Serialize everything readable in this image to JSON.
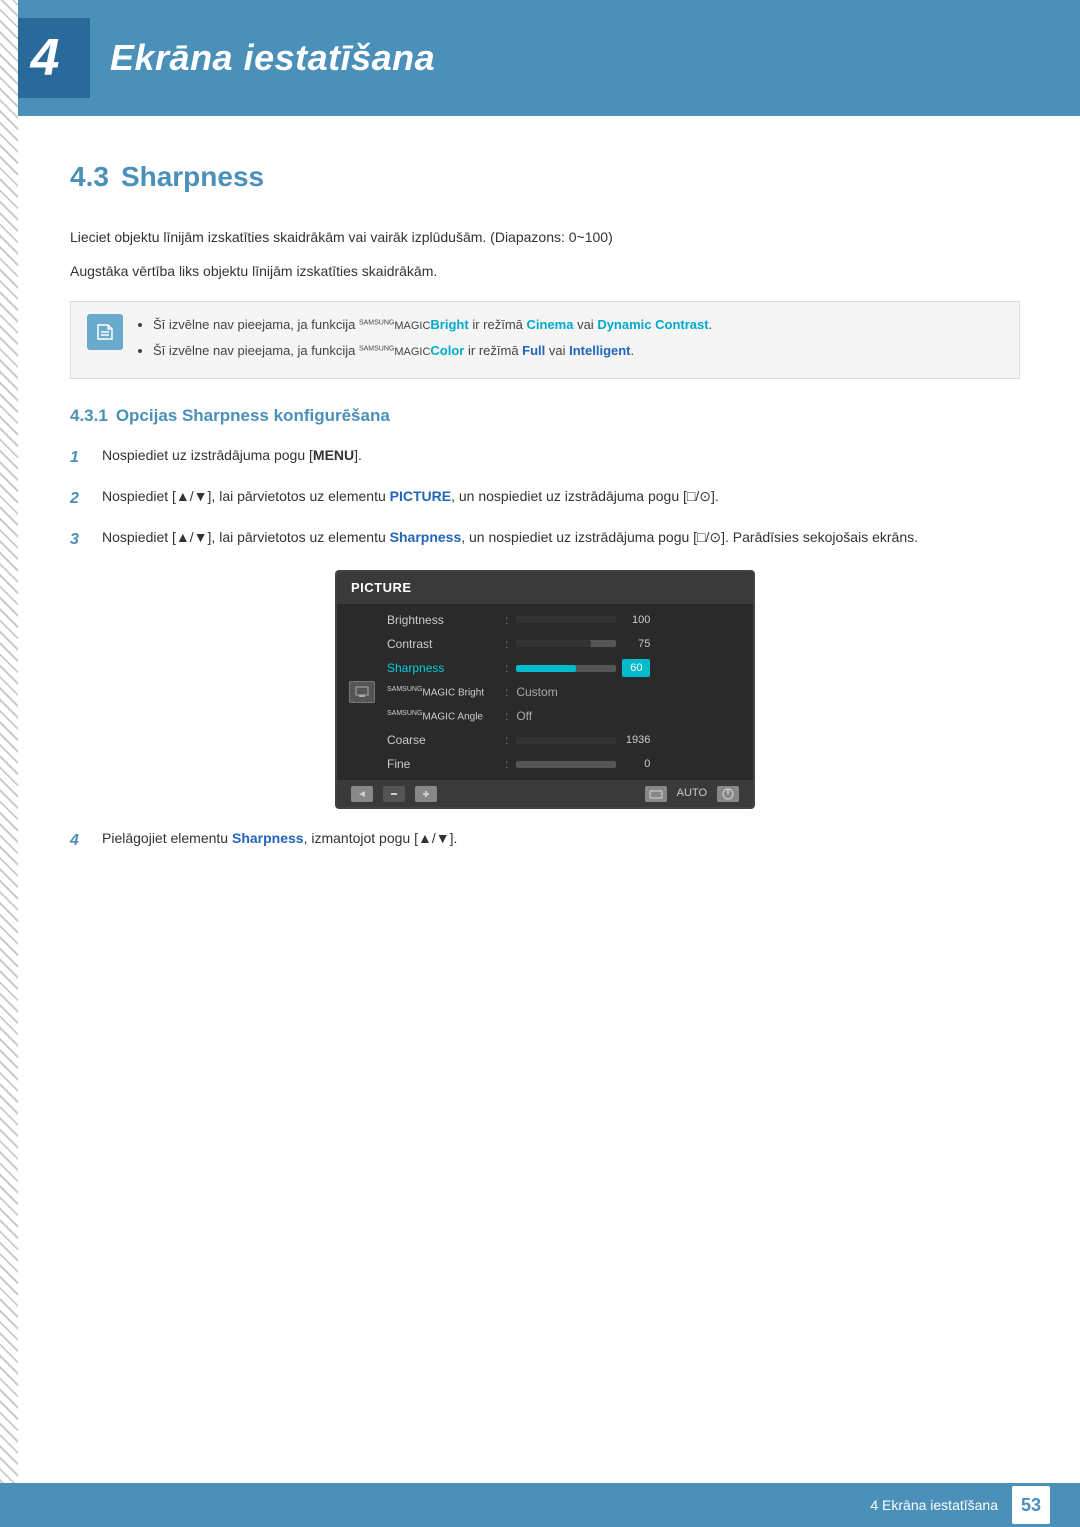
{
  "chapter": {
    "number": "4",
    "title": "Ekrāna iestatīšana"
  },
  "section": {
    "number": "4.3",
    "title": "Sharpness",
    "description1": "Lieciet objektu līnijām izskatīties skaidrākām vai vairāk izplūdušām. (Diapazons: 0~100)",
    "description2": "Augstāka vērtība liks objektu līnijām izskatīties skaidrākām.",
    "note1": "Šī izvēlne nav pieejama, ja funkcija ",
    "note1_brand": "SAMSUNG",
    "note1_magic": "MAGIC",
    "note1_feature": "Bright",
    "note1_mid": " ir režīmā ",
    "note1_cinema": "Cinema",
    "note1_or": " vai ",
    "note1_contrast": "Dynamic Contrast",
    "note1_end": ".",
    "note2": "Šī izvēlne nav pieejama, ja funkcija ",
    "note2_brand": "SAMSUNG",
    "note2_magic": "MAGIC",
    "note2_feature": "Color",
    "note2_mid": " ir režīmā ",
    "note2_full": "Full",
    "note2_or": " vai ",
    "note2_intelligent": "Intelligent",
    "note2_end": ".",
    "subsection": {
      "number": "4.3.1",
      "title": "Opcijas Sharpness konfigurēšana",
      "steps": [
        {
          "num": "1",
          "text": "Nospiediet uz izstrādājuma pogu [",
          "bold": "MENU",
          "text2": "]."
        },
        {
          "num": "2",
          "text": "Nospiediet [▲/▼], lai pārvietotos uz elementu ",
          "bold": "PICTURE",
          "text2": ", un nospiediet uz izstrādājuma pogu [□/⊙]."
        },
        {
          "num": "3",
          "text": "Nospiediet [▲/▼], lai pārvietotos uz elementu ",
          "bold": "Sharpness",
          "text2": ", un nospiediet uz izstrādājuma pogu [□/⊙]. Parādīsies sekojošais ekrāns."
        },
        {
          "num": "4",
          "text": "Pielāgojiet elementu ",
          "bold": "Sharpness",
          "text2": ", izmantojot pogu [▲/▼]."
        }
      ]
    }
  },
  "monitor_ui": {
    "title": "PICTURE",
    "rows": [
      {
        "label": "Brightness",
        "type": "bar",
        "fill": 100,
        "value": "100"
      },
      {
        "label": "Contrast",
        "type": "bar",
        "fill": 75,
        "value": "75"
      },
      {
        "label": "Sharpness",
        "type": "bar_selected",
        "fill": 60,
        "value": "60"
      },
      {
        "label": "SAMSUNG MAGIC Bright",
        "type": "text",
        "value": "Custom"
      },
      {
        "label": "SAMSUNG MAGIC Angle",
        "type": "text",
        "value": "Off"
      },
      {
        "label": "Coarse",
        "type": "bar",
        "fill": 100,
        "value": "1936"
      },
      {
        "label": "Fine",
        "type": "bar",
        "fill": 0,
        "value": "0"
      }
    ]
  },
  "footer": {
    "text": "4 Ekrāna iestatīšana",
    "page": "53"
  }
}
